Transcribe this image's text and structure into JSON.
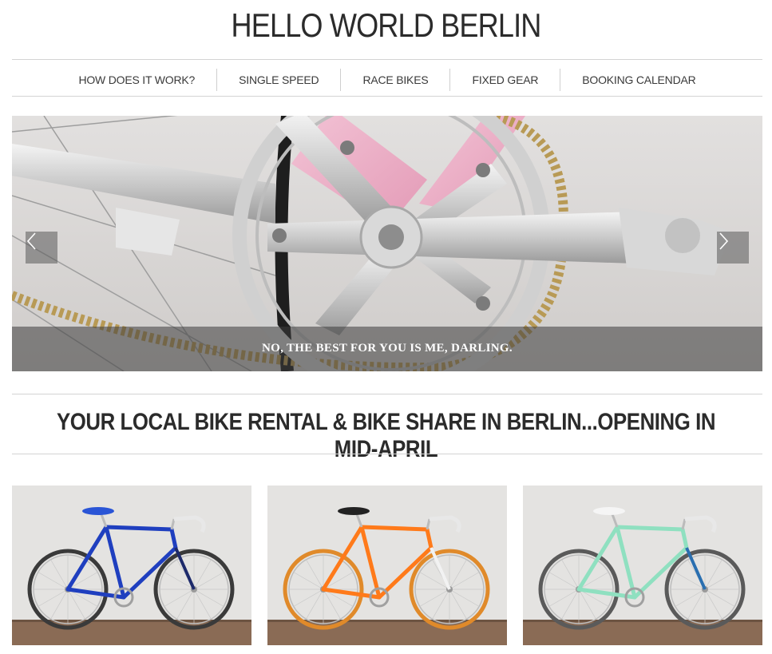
{
  "header": {
    "site_title": "HELLO WORLD BERLIN"
  },
  "nav": {
    "items": [
      {
        "label": "HOW DOES IT WORK?"
      },
      {
        "label": "SINGLE SPEED"
      },
      {
        "label": "RACE BIKES"
      },
      {
        "label": "FIXED GEAR"
      },
      {
        "label": "BOOKING CALENDAR"
      }
    ]
  },
  "slider": {
    "caption": "NO, THE BEST FOR YOU IS ME, DARLING.",
    "prev_icon": "chevron-left-icon",
    "next_icon": "chevron-right-icon"
  },
  "main": {
    "tagline": "YOUR LOCAL BIKE RENTAL & BIKE SHARE IN BERLIN...OPENING IN MID-APRIL"
  },
  "bikes": [
    {
      "frame_color": "#1f3fbf",
      "accent_color": "#1d2a6b",
      "saddle_color": "#2a55d6",
      "tire_color": "#3a3a3a"
    },
    {
      "frame_color": "#ff7a1a",
      "accent_color": "#f2f2f2",
      "saddle_color": "#222222",
      "tire_color": "#e08a2a"
    },
    {
      "frame_color": "#8fe0c0",
      "accent_color": "#2a6fb0",
      "saddle_color": "#f5f5f5",
      "tire_color": "#5a5a5a"
    }
  ],
  "colors": {
    "rule": "#d4d4d4",
    "text": "#2b2b2b",
    "wall": "#e4e3e1",
    "floor": "#8a6b55"
  }
}
